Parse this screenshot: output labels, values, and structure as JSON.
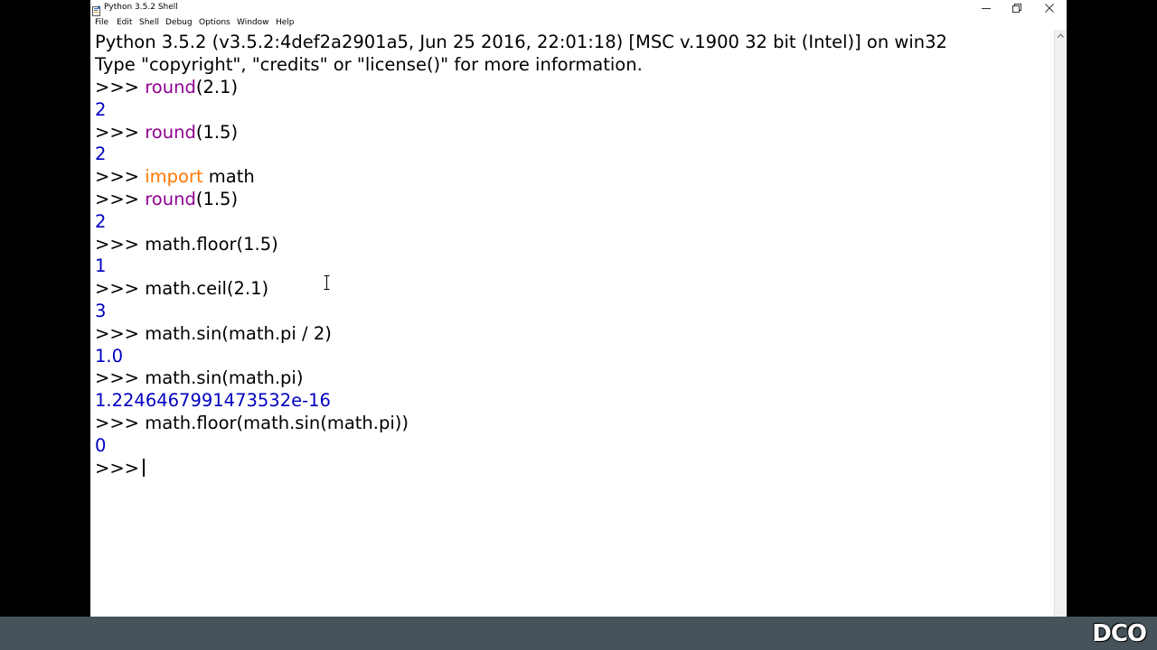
{
  "window": {
    "title": "Python 3.5.2 Shell"
  },
  "menu": {
    "items": [
      "File",
      "Edit",
      "Shell",
      "Debug",
      "Options",
      "Window",
      "Help"
    ]
  },
  "shell": {
    "banner_1": "Python 3.5.2 (v3.5.2:4def2a2901a5, Jun 25 2016, 22:01:18) [MSC v.1900 32 bit (Intel)] on win32",
    "banner_2": "Type \"copyright\", \"credits\" or \"license()\" for more information.",
    "prompt": ">>> ",
    "entries": [
      {
        "parts": [
          {
            "text": "round",
            "style": "builtin"
          },
          {
            "text": "(2.1)",
            "style": "plain"
          }
        ],
        "output": "2"
      },
      {
        "parts": [
          {
            "text": "round",
            "style": "builtin"
          },
          {
            "text": "(1.5)",
            "style": "plain"
          }
        ],
        "output": "2"
      },
      {
        "parts": [
          {
            "text": "import",
            "style": "keyword"
          },
          {
            "text": " math",
            "style": "plain"
          }
        ],
        "output": null
      },
      {
        "parts": [
          {
            "text": "round",
            "style": "builtin"
          },
          {
            "text": "(1.5)",
            "style": "plain"
          }
        ],
        "output": "2"
      },
      {
        "parts": [
          {
            "text": "math.floor(1.5)",
            "style": "plain"
          }
        ],
        "output": "1"
      },
      {
        "parts": [
          {
            "text": "math.ceil(2.1)",
            "style": "plain"
          }
        ],
        "output": "3"
      },
      {
        "parts": [
          {
            "text": "math.sin(math.pi / 2)",
            "style": "plain"
          }
        ],
        "output": "1.0"
      },
      {
        "parts": [
          {
            "text": "math.sin(math.pi)",
            "style": "plain"
          }
        ],
        "output": "1.2246467991473532e-16"
      },
      {
        "parts": [
          {
            "text": "math.floor(math.sin(math.pi))",
            "style": "plain"
          }
        ],
        "output": "0"
      }
    ]
  },
  "watermark": "DCO",
  "colors": {
    "output": "#0000c0",
    "keyword": "#ff7700",
    "builtin": "#900090",
    "taskbar": "#46535a",
    "background": "#ffffff"
  },
  "icons": [
    "python-shell-icon",
    "minimize-icon",
    "restore-icon",
    "close-icon",
    "scroll-up-arrow-icon",
    "text-cursor-icon"
  ]
}
